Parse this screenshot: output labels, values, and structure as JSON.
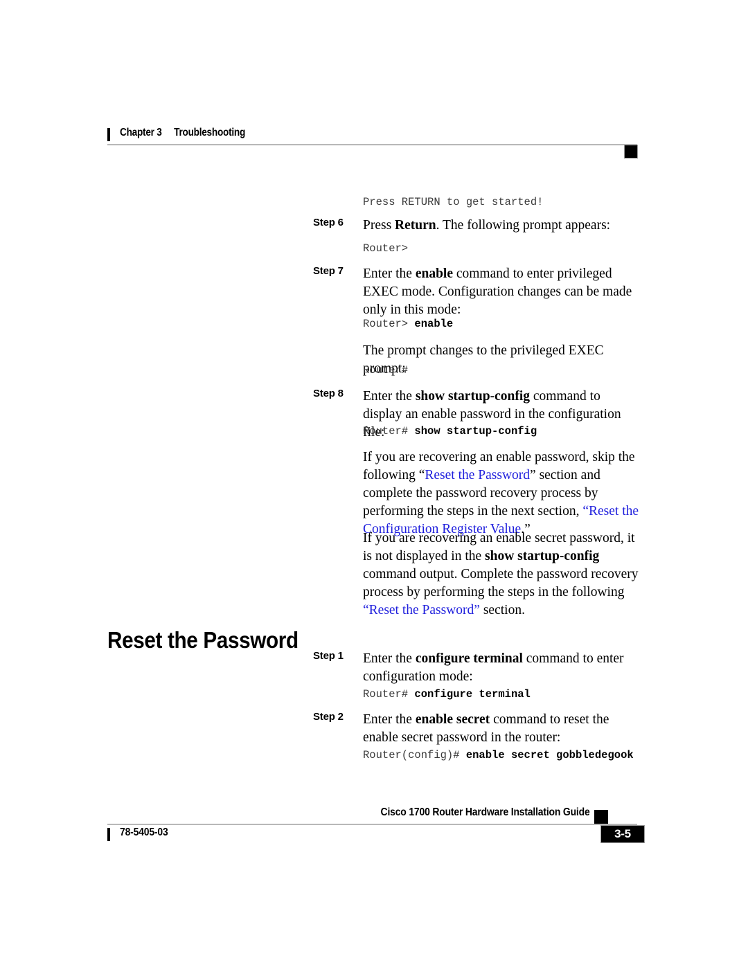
{
  "header": {
    "chapter": "Chapter 3",
    "title": "Troubleshooting"
  },
  "body": {
    "code_intro": "Press RETURN to get started!",
    "steps_continued": [
      {
        "label": "Step 6",
        "text_parts": {
          "a": "Press ",
          "b": "Return",
          "c": ". The following prompt appears:"
        },
        "code_prompt": "Router>",
        "code_command": ""
      },
      {
        "label": "Step 7",
        "text_parts": {
          "a": "Enter the ",
          "b": "enable",
          "c": " command to enter privileged EXEC mode. Configuration changes can be made only in this mode:"
        },
        "code_prompt": "Router> ",
        "code_command": "enable"
      },
      {
        "label": "Step 8",
        "text_parts": {
          "a": "Enter the ",
          "b": "show startup-config",
          "c": " command to display an enable password in the configuration file:"
        },
        "code_prompt": "Router# ",
        "code_command": "show startup-config"
      }
    ],
    "prompt_change_text": "The prompt changes to the privileged EXEC prompt:",
    "prompt_change_code": "Router#",
    "paragraph_enable_password": {
      "a": "If you are recovering an enable password, skip the following ",
      "quote_open_1": "“",
      "link_1": "Reset the Password",
      "quote_close_1": "”",
      "b": " section and complete the password recovery process by performing the steps in the next section, ",
      "quote_open_2": "“",
      "link_2": "Reset the Configuration Register Value",
      "quote_close_2": ".”"
    },
    "paragraph_enable_secret": {
      "a": "If you are recovering an enable secret password, it is not displayed in the ",
      "b": "show startup-config",
      "c": " command output. Complete the password recovery process by performing the steps in the following ",
      "link": "“Reset the Password”",
      "d": " section."
    }
  },
  "section": {
    "heading": "Reset the Password",
    "steps": [
      {
        "label": "Step 1",
        "text_parts": {
          "a": "Enter the ",
          "b": "configure terminal",
          "c": " command to enter configuration mode:"
        },
        "code_prompt": "Router# ",
        "code_command": "configure terminal"
      },
      {
        "label": "Step 2",
        "text_parts": {
          "a": "Enter the ",
          "b": "enable secret",
          "c": " command to reset the enable secret password in the router:"
        },
        "code_prompt": "Router(config)# ",
        "code_command": "enable secret gobbledegook"
      }
    ]
  },
  "footer": {
    "guide_title": "Cisco 1700 Router Hardware Installation Guide",
    "doc_number": "78-5405-03",
    "page_number": "3-5"
  },
  "colors": {
    "link": "#2020dd",
    "rule": "#b8b8b8",
    "text": "#000000",
    "code": "#3a3a3a"
  }
}
